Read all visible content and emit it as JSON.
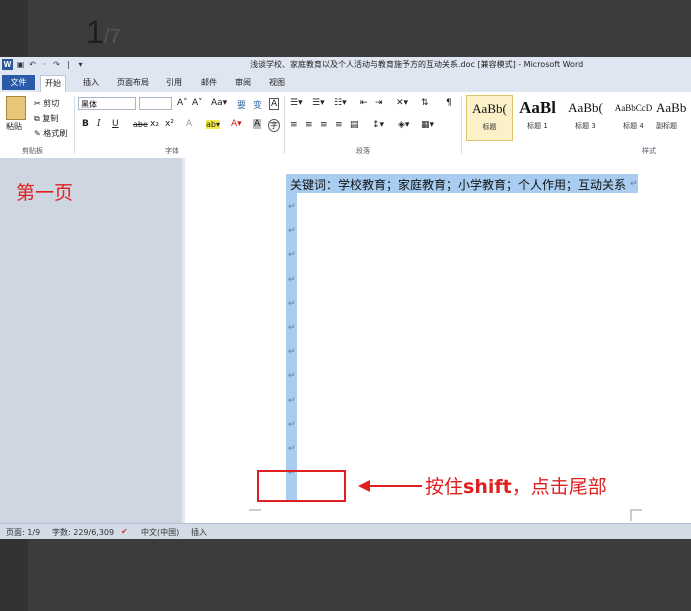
{
  "step": {
    "current": "1",
    "total": "/7"
  },
  "window": {
    "title": "浅谈学校、家庭教育以及个人活动与教育施予方的互动关系.doc [兼容模式] - Microsoft Word",
    "qat": [
      "W",
      "▣",
      "↶",
      "·",
      "↷",
      "|",
      "▾"
    ]
  },
  "ribbon_tabs": [
    "文件",
    "开始",
    "插入",
    "页面布局",
    "引用",
    "邮件",
    "审阅",
    "视图"
  ],
  "ribbon": {
    "clipboard": {
      "paste": "粘贴",
      "cut": "剪切",
      "copy": "复制",
      "format_painter": "格式刷",
      "group": "剪贴板"
    },
    "font": {
      "font_name": "黑体",
      "group": "字体",
      "grow": "A˄",
      "shrink": "A˅",
      "case": "Aa▾",
      "wen": "要",
      "bian": "变",
      "char_border": "A",
      "bold": "B",
      "italic": "I",
      "underline": "U",
      "strike": "abe",
      "sub": "x₂",
      "sup": "x²",
      "clear": "A",
      "highlight": "ab▾",
      "color": "A▾",
      "shade": "A",
      "circle": "字"
    },
    "paragraph": {
      "group": "段落"
    },
    "styles": {
      "group": "样式",
      "items": [
        {
          "sample": "AaBb(",
          "name": "标题"
        },
        {
          "sample": "AaBl",
          "name": "标题 1"
        },
        {
          "sample": "AaBb(",
          "name": "标题 3"
        },
        {
          "sample": "AaBbCcD",
          "name": "标题 4"
        },
        {
          "sample": "AaBb",
          "name": "副标题"
        }
      ]
    }
  },
  "document": {
    "keywords": "关键词：学校教育；家庭教育；小学教育；个人作用；互动关系",
    "para_mark": "↵",
    "blank_lines": 12
  },
  "status": {
    "page": "页面: 1/9",
    "words": "字数: 229/6,309",
    "lang": "中文(中国)",
    "mode": "插入"
  },
  "annotations": {
    "page_label": "第一页",
    "instruction_pre": "按住",
    "instruction_key": "shift",
    "instruction_post": "，点击尾部"
  },
  "colors": {
    "annotation": "#e02020",
    "selection": "#a8cdf0",
    "file_tab": "#2a5aa8"
  }
}
